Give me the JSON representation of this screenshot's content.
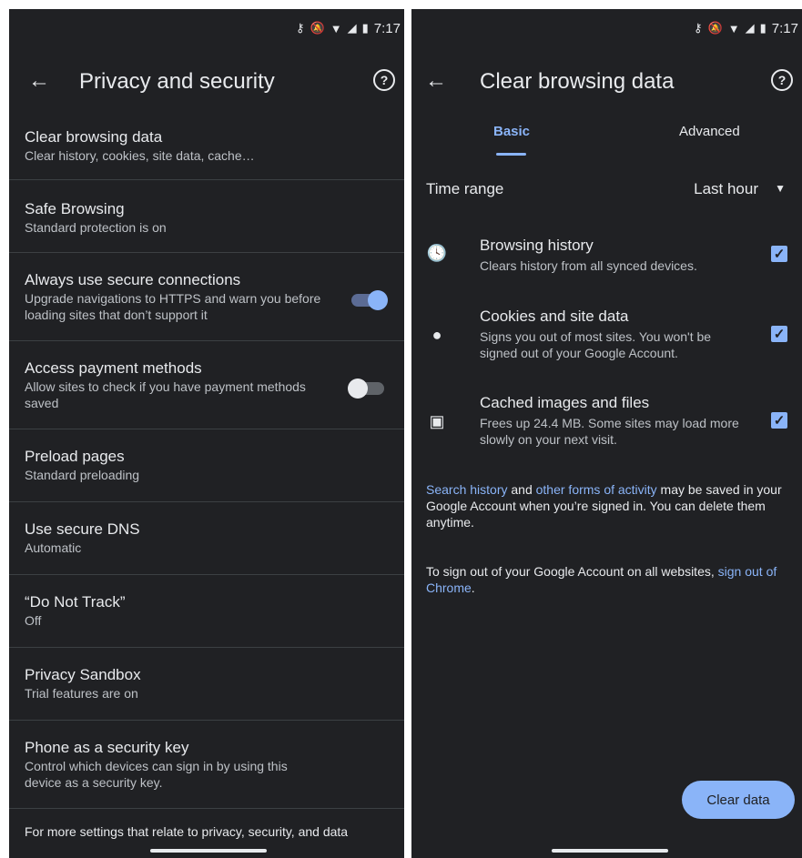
{
  "status_bar": {
    "time": "7:17"
  },
  "left": {
    "title": "Privacy and security",
    "items": [
      {
        "title": "Clear browsing data",
        "subtitle": "Clear history, cookies, site data, cache…"
      },
      {
        "title": "Safe Browsing",
        "subtitle": "Standard protection is on"
      },
      {
        "title": "Always use secure connections",
        "subtitle": "Upgrade navigations to HTTPS and warn you before loading sites that don’t support it",
        "toggle": "on"
      },
      {
        "title": "Access payment methods",
        "subtitle": "Allow sites to check if you have payment methods saved",
        "toggle": "off"
      },
      {
        "title": "Preload pages",
        "subtitle": "Standard preloading"
      },
      {
        "title": "Use secure DNS",
        "subtitle": "Automatic"
      },
      {
        "title": "“Do Not Track”",
        "subtitle": "Off"
      },
      {
        "title": "Privacy Sandbox",
        "subtitle": "Trial features are on"
      },
      {
        "title": "Phone as a security key",
        "subtitle": "Control which devices can sign in by using this device as a security key."
      }
    ],
    "footer": "For more settings that relate to privacy, security, and data"
  },
  "right": {
    "title": "Clear browsing data",
    "tabs": [
      "Basic",
      "Advanced"
    ],
    "time_range": {
      "label": "Time range",
      "value": "Last hour"
    },
    "options": [
      {
        "title": "Browsing history",
        "subtitle": "Clears history from all synced devices.",
        "icon": "clock-icon",
        "checked": true
      },
      {
        "title": "Cookies and site data",
        "subtitle": "Signs you out of most sites. You won't be signed out of your Google Account.",
        "icon": "cookie-icon",
        "checked": true
      },
      {
        "title": "Cached images and files",
        "subtitle": "Frees up 24.4 MB. Some sites may load more slowly on your next visit.",
        "icon": "image-icon",
        "checked": true
      }
    ],
    "note1": {
      "link1": "Search history",
      "and": " and ",
      "link2": "other forms of activity",
      "rest": " may be saved in your Google Account when you’re signed in. You can delete them anytime."
    },
    "note2": {
      "text": "To sign out of your Google Account on all websites, ",
      "link": "sign out of Chrome",
      "end": "."
    },
    "clear_button": "Clear data"
  },
  "colors": {
    "background": "#202124",
    "accent": "#8ab4f8",
    "text": "#e8eaed",
    "secondary_text": "#bdc1c6"
  }
}
